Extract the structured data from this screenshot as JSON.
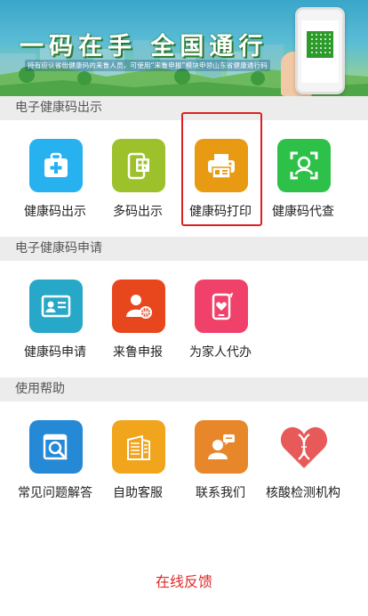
{
  "banner": {
    "title": "一码在手  全国通行",
    "subtitle": "持有应认省份健康码的来鲁人员，可使用“来鲁申报”模块申领山东省健康通行码"
  },
  "sections": [
    {
      "title": "电子健康码出示",
      "items": [
        {
          "label": "健康码出示",
          "icon": "medical-kit-icon",
          "color": "#27b2ef"
        },
        {
          "label": "多码出示",
          "icon": "multi-code-phone-icon",
          "color": "#9dc12a"
        },
        {
          "label": "健康码打印",
          "icon": "printer-icon",
          "color": "#e89a12"
        },
        {
          "label": "健康码代查",
          "icon": "face-scan-icon",
          "color": "#2ec14a"
        }
      ]
    },
    {
      "title": "电子健康码申请",
      "items": [
        {
          "label": "健康码申请",
          "icon": "id-card-icon",
          "color": "#27a8c9"
        },
        {
          "label": "来鲁申报",
          "icon": "person-globe-icon",
          "color": "#e8471e"
        },
        {
          "label": "为家人代办",
          "icon": "phone-heart-icon",
          "color": "#f0416a"
        }
      ]
    },
    {
      "title": "使用帮助",
      "items": [
        {
          "label": "常见问题解答",
          "icon": "faq-search-icon",
          "color": "#2589d6"
        },
        {
          "label": "自助客服",
          "icon": "building-icon",
          "color": "#f0a51c"
        },
        {
          "label": "联系我们",
          "icon": "contact-person-icon",
          "color": "#e8862a"
        },
        {
          "label": "核酸检测机构",
          "icon": "dna-heart-icon",
          "color": "#e85a5a"
        }
      ]
    }
  ],
  "feedback_label": "在线反馈"
}
